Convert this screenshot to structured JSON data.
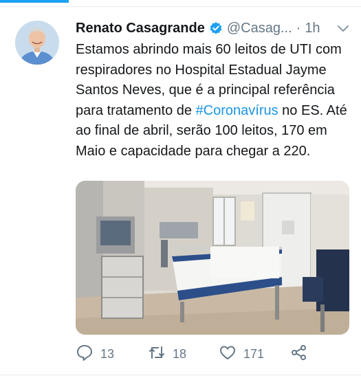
{
  "tweet": {
    "author_name": "Renato Casagrande",
    "handle": "@Casag...",
    "separator": "·",
    "time": "1h",
    "text": {
      "part1": "Estamos abrindo mais 60 leitos de UTI com respiradores no Hospital Estadual Jayme Santos Neves, que é a principal referência para tratamento de ",
      "hashtag": "#Coronavírus",
      "part2": " no ES. Até ao final de abril, serão 100 leitos, 170 em Maio e capacidade para chegar a 220."
    },
    "actions": {
      "reply_count": "13",
      "retweet_count": "18",
      "like_count": "171"
    },
    "icons": {
      "verified": "verified-badge-icon",
      "more": "chevron-down-icon",
      "reply": "reply-icon",
      "retweet": "retweet-icon",
      "like": "heart-icon",
      "share": "share-icon"
    }
  },
  "colors": {
    "accent": "#1da1f2",
    "hashtag": "#1b95e0",
    "muted": "#657786",
    "text": "#14171a"
  }
}
